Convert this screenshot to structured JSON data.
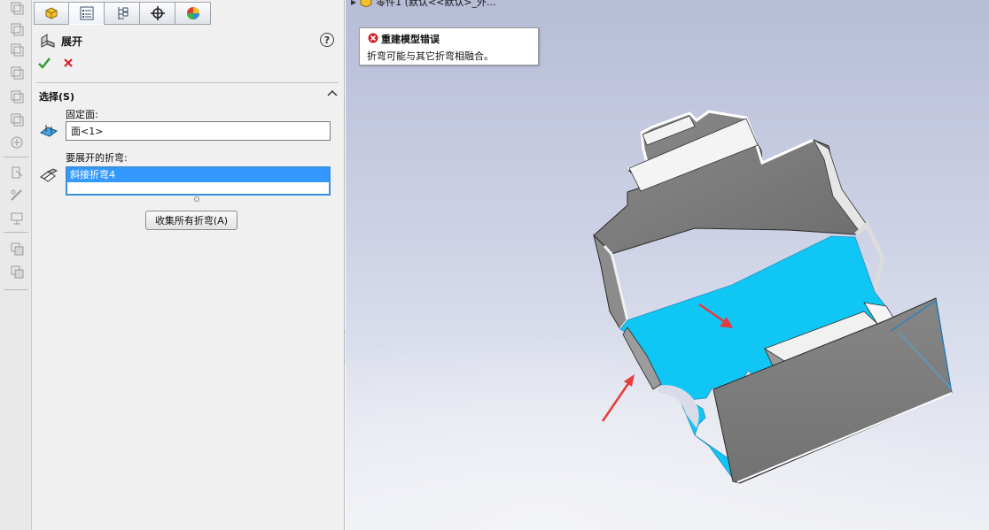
{
  "left_toolbar": {
    "icons": [
      "feature-tree-icon",
      "sketch-view-icon",
      "top-view-icon",
      "front-view-icon",
      "right-view-icon",
      "iso-view-icon",
      "orient-icon",
      "section-icon",
      "measure-icon",
      "evaluate-icon",
      "layer-icon",
      "layer-copy-icon"
    ]
  },
  "panel_tabs": [
    {
      "name": "feature-manager-tab",
      "icon": "feature-manager-icon"
    },
    {
      "name": "property-manager-tab",
      "icon": "property-manager-icon",
      "active": true
    },
    {
      "name": "configuration-manager-tab",
      "icon": "configuration-manager-icon"
    },
    {
      "name": "dimxpert-manager-tab",
      "icon": "crosshair-icon"
    },
    {
      "name": "display-manager-tab",
      "icon": "color-wheel-icon"
    }
  ],
  "feature": {
    "title": "展开",
    "help": "?"
  },
  "selection": {
    "section_title": "选择(S)",
    "fixed_face_label": "固定面:",
    "fixed_face_value": "面<1>",
    "bends_label": "要展开的折弯:",
    "bends_items": [
      "斜接折弯4"
    ],
    "collect_button": "收集所有折弯(A)"
  },
  "viewport": {
    "tree_item": "零件1 (默认<<默认>_外...",
    "error": {
      "title": "重建模型错误",
      "message": "折弯可能与其它折弯相融合。"
    }
  },
  "colors": {
    "selected_face": "#10c6f4",
    "model_gray": "#7a7a7a",
    "arrow_red": "#e73c3c",
    "list_selection": "#3399ff"
  }
}
